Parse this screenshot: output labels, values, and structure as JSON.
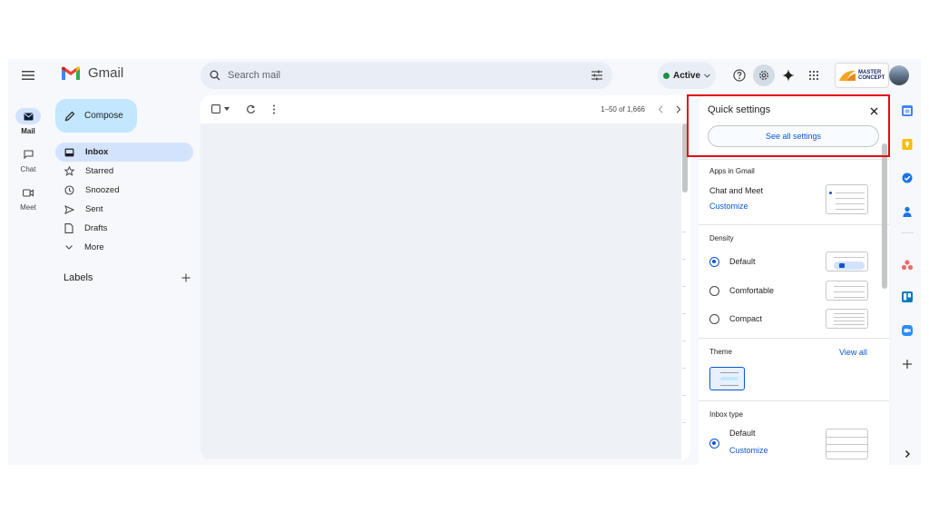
{
  "app": {
    "name": "Gmail",
    "search_placeholder": "Search mail",
    "status": "Active",
    "brand": {
      "line1": "MASTER",
      "line2": "CONCEPT"
    }
  },
  "rail": [
    {
      "label": "Mail",
      "icon": "mail-icon",
      "selected": true
    },
    {
      "label": "Chat",
      "icon": "chat-icon",
      "selected": false
    },
    {
      "label": "Meet",
      "icon": "meet-icon",
      "selected": false
    }
  ],
  "nav": {
    "compose": "Compose",
    "items": [
      {
        "label": "Inbox",
        "icon": "inbox-icon",
        "selected": true
      },
      {
        "label": "Starred",
        "icon": "star-icon"
      },
      {
        "label": "Snoozed",
        "icon": "clock-icon"
      },
      {
        "label": "Sent",
        "icon": "send-icon"
      },
      {
        "label": "Drafts",
        "icon": "draft-icon"
      },
      {
        "label": "More",
        "icon": "chevron-down-icon"
      }
    ],
    "labels_heading": "Labels"
  },
  "toolbar": {
    "pagination": "1–50 of 1,666"
  },
  "quick_settings": {
    "title": "Quick settings",
    "see_all": "See all settings",
    "apps_heading": "Apps in Gmail",
    "apps_item": "Chat and Meet",
    "apps_customize": "Customize",
    "density_heading": "Density",
    "density_options": [
      "Default",
      "Comfortable",
      "Compact"
    ],
    "density_selected": "Default",
    "theme_heading": "Theme",
    "theme_view_all": "View all",
    "inbox_type_heading": "Inbox type",
    "inbox_type_option": "Default",
    "inbox_type_customize": "Customize"
  },
  "colors": {
    "accent": "#0b57d0",
    "selected_bg": "#d3e3fd",
    "compose_bg": "#c2e7ff",
    "highlight": "#e50914"
  }
}
